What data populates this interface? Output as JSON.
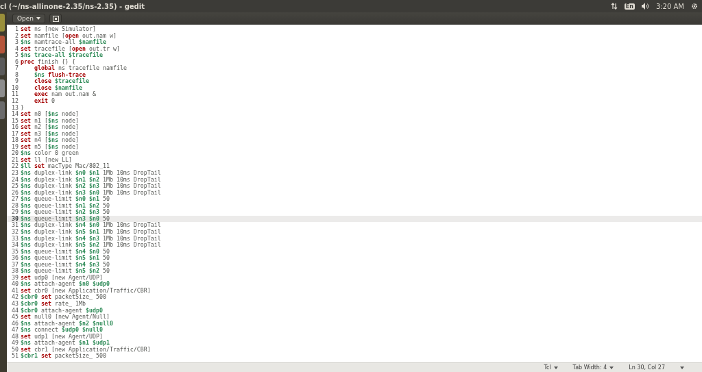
{
  "top_bar": {
    "title": "cl (~/ns-allinone-2.35/ns-2.35) - gedit",
    "keyboard": "En",
    "clock": "3:20 AM"
  },
  "toolbar": {
    "open_button": "Open"
  },
  "editor": {
    "lines": [
      {
        "number": "1",
        "current": false,
        "indented": false,
        "segments": [
          {
            "kind": "keyword",
            "text": "set"
          },
          {
            "kind": "plain",
            "text": " ns [new Simulator]"
          }
        ]
      },
      {
        "number": "2",
        "current": false,
        "indented": false,
        "segments": [
          {
            "kind": "keyword",
            "text": "set"
          },
          {
            "kind": "plain",
            "text": " namfile ["
          },
          {
            "kind": "keyword",
            "text": "open"
          },
          {
            "kind": "plain",
            "text": " out.nam w]"
          }
        ]
      },
      {
        "number": "3",
        "current": false,
        "indented": false,
        "segments": [
          {
            "kind": "variable",
            "text": "$ns"
          },
          {
            "kind": "plain",
            "text": " namtrace-all "
          },
          {
            "kind": "variable",
            "text": "$namfile"
          }
        ]
      },
      {
        "number": "4",
        "current": false,
        "indented": false,
        "segments": [
          {
            "kind": "keyword",
            "text": "set"
          },
          {
            "kind": "plain",
            "text": " tracefile ["
          },
          {
            "kind": "keyword",
            "text": "open"
          },
          {
            "kind": "plain",
            "text": " out.tr w]"
          }
        ]
      },
      {
        "number": "5",
        "current": false,
        "indented": false,
        "segments": [
          {
            "kind": "variable",
            "text": "$ns trace-all $tracefile"
          }
        ]
      },
      {
        "number": "6",
        "current": false,
        "indented": false,
        "segments": [
          {
            "kind": "keyword",
            "text": "proc"
          },
          {
            "kind": "plain",
            "text": " finish {} {"
          }
        ]
      },
      {
        "number": "7",
        "current": false,
        "indented": true,
        "segments": [
          {
            "kind": "keyword",
            "text": "global"
          },
          {
            "kind": "plain",
            "text": " ns tracefile namfile"
          }
        ]
      },
      {
        "number": "8",
        "current": false,
        "indented": true,
        "segments": [
          {
            "kind": "variable",
            "text": "$ns"
          },
          {
            "kind": "keyword",
            "text": " flush-trace"
          }
        ]
      },
      {
        "number": "9",
        "current": false,
        "indented": true,
        "segments": [
          {
            "kind": "keyword",
            "text": "close"
          },
          {
            "kind": "variable",
            "text": " $tracefile"
          }
        ]
      },
      {
        "number": "10",
        "current": false,
        "indented": true,
        "segments": [
          {
            "kind": "keyword",
            "text": "close"
          },
          {
            "kind": "variable",
            "text": " $namfile"
          }
        ]
      },
      {
        "number": "11",
        "current": false,
        "indented": true,
        "segments": [
          {
            "kind": "keyword",
            "text": "exec"
          },
          {
            "kind": "plain",
            "text": " nam out.nam &"
          }
        ]
      },
      {
        "number": "12",
        "current": false,
        "indented": true,
        "segments": [
          {
            "kind": "keyword",
            "text": "exit"
          },
          {
            "kind": "plain",
            "text": " 0"
          }
        ]
      },
      {
        "number": "13",
        "current": false,
        "indented": false,
        "segments": [
          {
            "kind": "plain",
            "text": "}"
          }
        ]
      },
      {
        "number": "14",
        "current": false,
        "indented": false,
        "segments": [
          {
            "kind": "keyword",
            "text": "set"
          },
          {
            "kind": "plain",
            "text": " n0 ["
          },
          {
            "kind": "variable",
            "text": "$ns"
          },
          {
            "kind": "plain",
            "text": " node]"
          }
        ]
      },
      {
        "number": "15",
        "current": false,
        "indented": false,
        "segments": [
          {
            "kind": "keyword",
            "text": "set"
          },
          {
            "kind": "plain",
            "text": " n1 ["
          },
          {
            "kind": "variable",
            "text": "$ns"
          },
          {
            "kind": "plain",
            "text": " node]"
          }
        ]
      },
      {
        "number": "16",
        "current": false,
        "indented": false,
        "segments": [
          {
            "kind": "keyword",
            "text": "set"
          },
          {
            "kind": "plain",
            "text": " n2 ["
          },
          {
            "kind": "variable",
            "text": "$ns"
          },
          {
            "kind": "plain",
            "text": " node]"
          }
        ]
      },
      {
        "number": "17",
        "current": false,
        "indented": false,
        "segments": [
          {
            "kind": "keyword",
            "text": "set"
          },
          {
            "kind": "plain",
            "text": " n3 ["
          },
          {
            "kind": "variable",
            "text": "$ns"
          },
          {
            "kind": "plain",
            "text": " node]"
          }
        ]
      },
      {
        "number": "18",
        "current": false,
        "indented": false,
        "segments": [
          {
            "kind": "keyword",
            "text": "set"
          },
          {
            "kind": "plain",
            "text": " n4 ["
          },
          {
            "kind": "variable",
            "text": "$ns"
          },
          {
            "kind": "plain",
            "text": " node]"
          }
        ]
      },
      {
        "number": "19",
        "current": false,
        "indented": false,
        "segments": [
          {
            "kind": "keyword",
            "text": "set"
          },
          {
            "kind": "plain",
            "text": " n5 ["
          },
          {
            "kind": "variable",
            "text": "$ns"
          },
          {
            "kind": "plain",
            "text": " node]"
          }
        ]
      },
      {
        "number": "20",
        "current": false,
        "indented": false,
        "segments": [
          {
            "kind": "variable",
            "text": "$ns"
          },
          {
            "kind": "plain",
            "text": " color 0 green"
          }
        ]
      },
      {
        "number": "21",
        "current": false,
        "indented": false,
        "segments": [
          {
            "kind": "keyword",
            "text": "set"
          },
          {
            "kind": "plain",
            "text": " ll [new LL]"
          }
        ]
      },
      {
        "number": "22",
        "current": false,
        "indented": false,
        "segments": [
          {
            "kind": "variable",
            "text": "$ll"
          },
          {
            "kind": "keyword",
            "text": " set"
          },
          {
            "kind": "plain",
            "text": " macType Mac/802_11"
          }
        ]
      },
      {
        "number": "23",
        "current": false,
        "indented": false,
        "segments": [
          {
            "kind": "variable",
            "text": "$ns"
          },
          {
            "kind": "plain",
            "text": " duplex-link "
          },
          {
            "kind": "variable",
            "text": "$n0 $n1"
          },
          {
            "kind": "plain",
            "text": " 1Mb 10ms DropTail"
          }
        ]
      },
      {
        "number": "24",
        "current": false,
        "indented": false,
        "segments": [
          {
            "kind": "variable",
            "text": "$ns"
          },
          {
            "kind": "plain",
            "text": " duplex-link "
          },
          {
            "kind": "variable",
            "text": "$n1 $n2"
          },
          {
            "kind": "plain",
            "text": " 1Mb 10ms DropTail"
          }
        ]
      },
      {
        "number": "25",
        "current": false,
        "indented": false,
        "segments": [
          {
            "kind": "variable",
            "text": "$ns"
          },
          {
            "kind": "plain",
            "text": " duplex-link "
          },
          {
            "kind": "variable",
            "text": "$n2 $n3"
          },
          {
            "kind": "plain",
            "text": " 1Mb 10ms DropTail"
          }
        ]
      },
      {
        "number": "26",
        "current": false,
        "indented": false,
        "segments": [
          {
            "kind": "variable",
            "text": "$ns"
          },
          {
            "kind": "plain",
            "text": " duplex-link "
          },
          {
            "kind": "variable",
            "text": "$n3 $n0"
          },
          {
            "kind": "plain",
            "text": " 1Mb 10ms DropTail"
          }
        ]
      },
      {
        "number": "27",
        "current": false,
        "indented": false,
        "segments": [
          {
            "kind": "variable",
            "text": "$ns"
          },
          {
            "kind": "plain",
            "text": " queue-limit "
          },
          {
            "kind": "variable",
            "text": "$n0 $n1"
          },
          {
            "kind": "plain",
            "text": " 50"
          }
        ]
      },
      {
        "number": "28",
        "current": false,
        "indented": false,
        "segments": [
          {
            "kind": "variable",
            "text": "$ns"
          },
          {
            "kind": "plain",
            "text": " queue-limit "
          },
          {
            "kind": "variable",
            "text": "$n1 $n2"
          },
          {
            "kind": "plain",
            "text": " 50"
          }
        ]
      },
      {
        "number": "29",
        "current": false,
        "indented": false,
        "segments": [
          {
            "kind": "variable",
            "text": "$ns"
          },
          {
            "kind": "plain",
            "text": " queue-limit "
          },
          {
            "kind": "variable",
            "text": "$n2 $n3"
          },
          {
            "kind": "plain",
            "text": " 50"
          }
        ]
      },
      {
        "number": "30",
        "current": true,
        "indented": false,
        "segments": [
          {
            "kind": "variable",
            "text": "$ns"
          },
          {
            "kind": "plain",
            "text": " queue-limit "
          },
          {
            "kind": "variable",
            "text": "$n3 $n0"
          },
          {
            "kind": "plain",
            "text": " 50"
          }
        ]
      },
      {
        "number": "31",
        "current": false,
        "indented": false,
        "segments": [
          {
            "kind": "variable",
            "text": "$ns"
          },
          {
            "kind": "plain",
            "text": " duplex-link "
          },
          {
            "kind": "variable",
            "text": "$n4 $n0"
          },
          {
            "kind": "plain",
            "text": " 1Mb 10ms DropTail"
          }
        ]
      },
      {
        "number": "32",
        "current": false,
        "indented": false,
        "segments": [
          {
            "kind": "variable",
            "text": "$ns"
          },
          {
            "kind": "plain",
            "text": " duplex-link "
          },
          {
            "kind": "variable",
            "text": "$n5 $n1"
          },
          {
            "kind": "plain",
            "text": " 1Mb 10ms DropTail"
          }
        ]
      },
      {
        "number": "33",
        "current": false,
        "indented": false,
        "segments": [
          {
            "kind": "variable",
            "text": "$ns"
          },
          {
            "kind": "plain",
            "text": " duplex-link "
          },
          {
            "kind": "variable",
            "text": "$n4 $n3"
          },
          {
            "kind": "plain",
            "text": " 1Mb 10ms DropTail"
          }
        ]
      },
      {
        "number": "34",
        "current": false,
        "indented": false,
        "segments": [
          {
            "kind": "variable",
            "text": "$ns"
          },
          {
            "kind": "plain",
            "text": " duplex-link "
          },
          {
            "kind": "variable",
            "text": "$n5 $n2"
          },
          {
            "kind": "plain",
            "text": " 1Mb 10ms DropTail"
          }
        ]
      },
      {
        "number": "35",
        "current": false,
        "indented": false,
        "segments": [
          {
            "kind": "variable",
            "text": "$ns"
          },
          {
            "kind": "plain",
            "text": " queue-limit "
          },
          {
            "kind": "variable",
            "text": "$n4 $n0"
          },
          {
            "kind": "plain",
            "text": " 50"
          }
        ]
      },
      {
        "number": "36",
        "current": false,
        "indented": false,
        "segments": [
          {
            "kind": "variable",
            "text": "$ns"
          },
          {
            "kind": "plain",
            "text": " queue-limit "
          },
          {
            "kind": "variable",
            "text": "$n5 $n1"
          },
          {
            "kind": "plain",
            "text": " 50"
          }
        ]
      },
      {
        "number": "37",
        "current": false,
        "indented": false,
        "segments": [
          {
            "kind": "variable",
            "text": "$ns"
          },
          {
            "kind": "plain",
            "text": " queue-limit "
          },
          {
            "kind": "variable",
            "text": "$n4 $n3"
          },
          {
            "kind": "plain",
            "text": " 50"
          }
        ]
      },
      {
        "number": "38",
        "current": false,
        "indented": false,
        "segments": [
          {
            "kind": "variable",
            "text": "$ns"
          },
          {
            "kind": "plain",
            "text": " queue-limit "
          },
          {
            "kind": "variable",
            "text": "$n5 $n2"
          },
          {
            "kind": "plain",
            "text": " 50"
          }
        ]
      },
      {
        "number": "39",
        "current": false,
        "indented": false,
        "segments": [
          {
            "kind": "keyword",
            "text": "set"
          },
          {
            "kind": "plain",
            "text": " udp0 [new Agent/UDP]"
          }
        ]
      },
      {
        "number": "40",
        "current": false,
        "indented": false,
        "segments": [
          {
            "kind": "variable",
            "text": "$ns"
          },
          {
            "kind": "plain",
            "text": " attach-agent "
          },
          {
            "kind": "variable",
            "text": "$n0 $udp0"
          }
        ]
      },
      {
        "number": "41",
        "current": false,
        "indented": false,
        "segments": [
          {
            "kind": "keyword",
            "text": "set"
          },
          {
            "kind": "plain",
            "text": " cbr0 [new Application/Traffic/CBR]"
          }
        ]
      },
      {
        "number": "42",
        "current": false,
        "indented": false,
        "segments": [
          {
            "kind": "variable",
            "text": "$cbr0"
          },
          {
            "kind": "keyword",
            "text": " set"
          },
          {
            "kind": "plain",
            "text": " packetSize_ 500"
          }
        ]
      },
      {
        "number": "43",
        "current": false,
        "indented": false,
        "segments": [
          {
            "kind": "variable",
            "text": "$cbr0"
          },
          {
            "kind": "keyword",
            "text": " set"
          },
          {
            "kind": "plain",
            "text": " rate_ 1Mb"
          }
        ]
      },
      {
        "number": "44",
        "current": false,
        "indented": false,
        "segments": [
          {
            "kind": "variable",
            "text": "$cbr0"
          },
          {
            "kind": "plain",
            "text": " attach-agent "
          },
          {
            "kind": "variable",
            "text": "$udp0"
          }
        ]
      },
      {
        "number": "45",
        "current": false,
        "indented": false,
        "segments": [
          {
            "kind": "keyword",
            "text": "set"
          },
          {
            "kind": "plain",
            "text": " null0 [new Agent/Null]"
          }
        ]
      },
      {
        "number": "46",
        "current": false,
        "indented": false,
        "segments": [
          {
            "kind": "variable",
            "text": "$ns"
          },
          {
            "kind": "plain",
            "text": " attach-agent "
          },
          {
            "kind": "variable",
            "text": "$n2 $null0"
          }
        ]
      },
      {
        "number": "47",
        "current": false,
        "indented": false,
        "segments": [
          {
            "kind": "variable",
            "text": "$ns"
          },
          {
            "kind": "plain",
            "text": " connect "
          },
          {
            "kind": "variable",
            "text": "$udp0 $null0"
          }
        ]
      },
      {
        "number": "48",
        "current": false,
        "indented": false,
        "segments": [
          {
            "kind": "keyword",
            "text": "set"
          },
          {
            "kind": "plain",
            "text": " udp1 [new Agent/UDP]"
          }
        ]
      },
      {
        "number": "49",
        "current": false,
        "indented": false,
        "segments": [
          {
            "kind": "variable",
            "text": "$ns"
          },
          {
            "kind": "plain",
            "text": " attach-agent "
          },
          {
            "kind": "variable",
            "text": "$n1 $udp1"
          }
        ]
      },
      {
        "number": "50",
        "current": false,
        "indented": false,
        "segments": [
          {
            "kind": "keyword",
            "text": "set"
          },
          {
            "kind": "plain",
            "text": " cbr1 [new Application/Traffic/CBR]"
          }
        ]
      },
      {
        "number": "51",
        "current": false,
        "indented": false,
        "segments": [
          {
            "kind": "variable",
            "text": "$cbr1"
          },
          {
            "kind": "keyword",
            "text": " set"
          },
          {
            "kind": "plain",
            "text": " packetSize_ 500"
          }
        ]
      }
    ]
  },
  "status_bar": {
    "language": "Tcl",
    "tab_width": "Tab Width: 4",
    "position": "Ln 30, Col 27"
  }
}
